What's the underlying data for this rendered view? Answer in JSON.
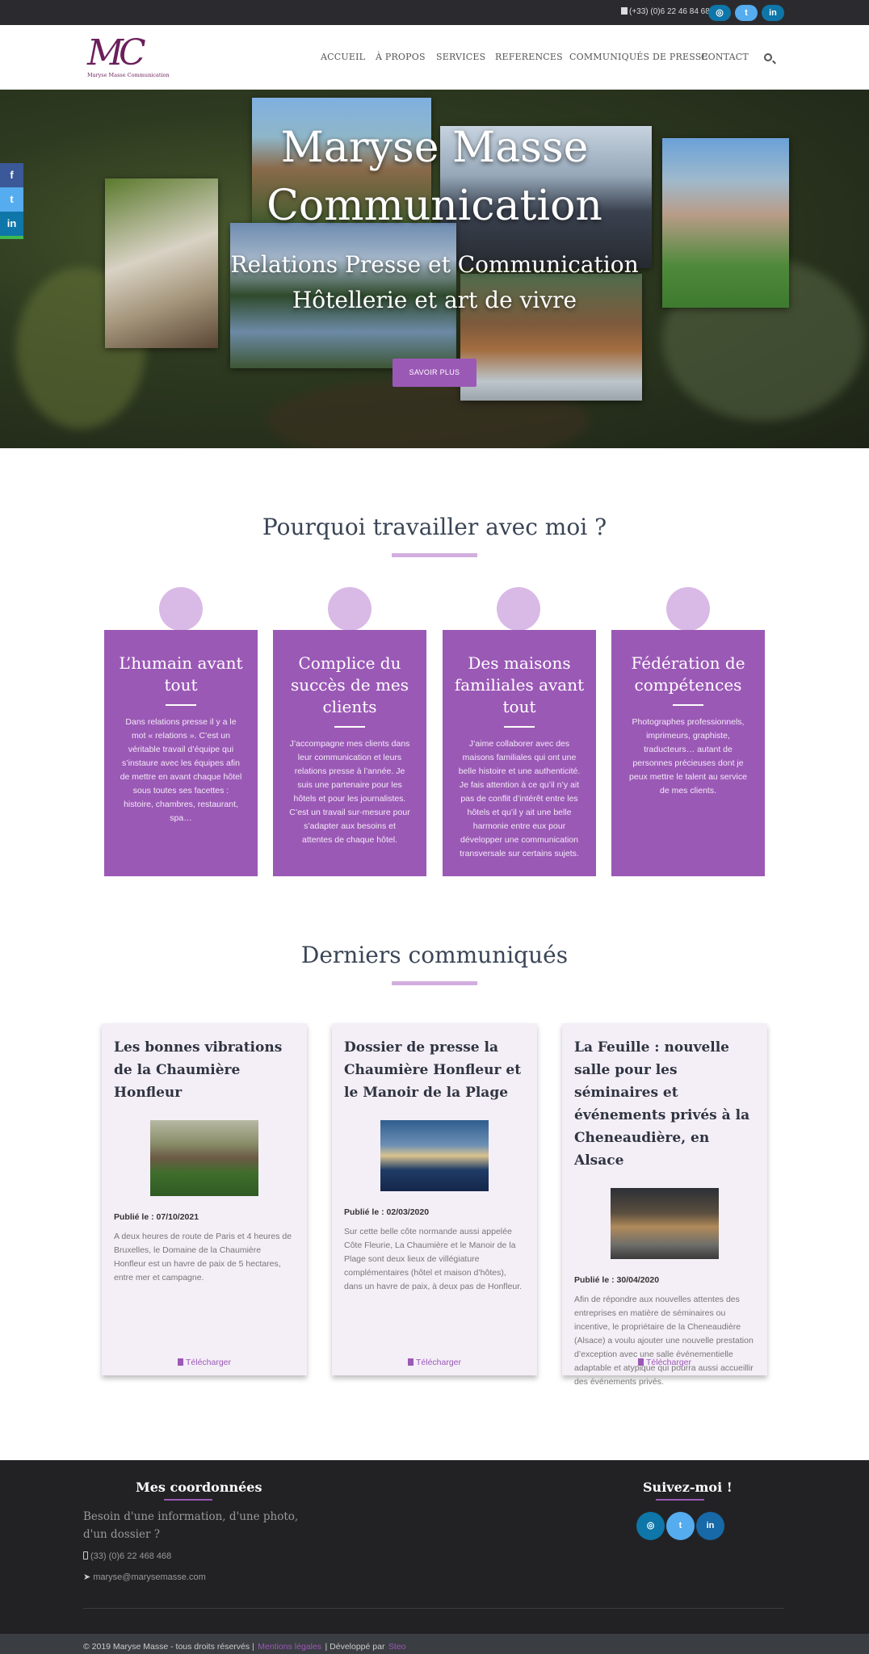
{
  "topbar": {
    "phone": "(+33) (0)6 22 46 84 68",
    "social": [
      "instagram-icon",
      "twitter-icon",
      "linkedin-icon"
    ]
  },
  "header": {
    "logo_letters": "MC",
    "logo_subtitle": "Maryse Masse Communication",
    "nav": [
      "ACCUEIL",
      "À PROPOS",
      "SERVICES",
      "REFERENCES",
      "COMMUNIQUÉS DE PRESSE",
      "CONTACT"
    ]
  },
  "hero": {
    "title_line1": "Maryse Masse",
    "title_line2": "Communication",
    "subtitle_line1": "Relations Presse et Communication",
    "subtitle_line2": "Hôtellerie et art de vivre",
    "button": "SAVOIR PLUS"
  },
  "side_social": [
    "f",
    "t",
    "in"
  ],
  "why": {
    "title": "Pourquoi travailler avec moi ?",
    "cards": [
      {
        "icon": "people-icon",
        "title": "L’humain avant tout",
        "text": "Dans relations presse il y a le mot « relations ». C’est un véritable travail d’équipe qui s’instaure avec les équipes afin de mettre en avant chaque hôtel sous toutes ses facettes : histoire, chambres, restaurant, spa…"
      },
      {
        "icon": "comments-icon",
        "title": "Complice du succès de mes clients",
        "text": "J’accompagne mes clients dans leur communication et leurs relations presse à l’année. Je suis une partenaire pour les hôtels et pour les journalistes. C’est un travail sur-mesure pour s’adapter aux besoins et attentes de chaque hôtel."
      },
      {
        "icon": "feather-icon",
        "title": "Des maisons familiales avant tout",
        "text": "J’aime collaborer avec des maisons familiales qui ont une belle histoire et une authenticité. Je fais attention à ce qu’il n’y ait pas de conflit d’intérêt entre les hôtels et qu’il y ait une belle harmonie entre eux pour développer une communication transversale sur certains sujets."
      },
      {
        "icon": "sitemap-icon",
        "title": "Fédération de compétences",
        "text": "Photographes professionnels, imprimeurs, graphiste, traducteurs… autant de personnes précieuses dont je peux mettre le talent au service de mes clients."
      }
    ]
  },
  "communiques": {
    "title": "Derniers communiqués",
    "items": [
      {
        "title": "Les bonnes vibrations de la Chaumière Honfleur",
        "date": "Publié le : 07/10/2021",
        "text": "A deux heures de route de Paris et 4 heures de Bruxelles, le Domaine de la Chaumière Honfleur est un havre de paix de 5 hectares, entre mer et campagne.",
        "download": "Télécharger"
      },
      {
        "title": "Dossier de presse la Chaumière Honfleur et le Manoir de la Plage",
        "date": "Publié le : 02/03/2020",
        "text": "Sur cette belle côte normande aussi appelée Côte Fleurie, La Chaumière et le Manoir de la Plage sont deux lieux de villégiature complémentaires (hôtel et maison d’hôtes), dans un havre de paix, à deux pas de Honfleur.",
        "download": "Télécharger"
      },
      {
        "title": "La Feuille : nouvelle salle pour les séminaires et événements privés à la Cheneaudière, en Alsace",
        "date": "Publié le : 30/04/2020",
        "text": "Afin de répondre aux nouvelles attentes des entreprises en matière de séminaires ou incentive, le propriétaire de la Cheneaudière (Alsace) a voulu ajouter une nouvelle prestation d’exception avec une salle événementielle adaptable et atypique qui pourra aussi accueillir des événements privés.",
        "download": "Télécharger"
      }
    ]
  },
  "footer": {
    "contact_title": "Mes coordonnées",
    "contact_text": "Besoin d'une information, d'une photo, d'un dossier ?",
    "phone": "(33) (0)6 22 468 468",
    "email": "maryse@marysemasse.com",
    "follow_title": "Suivez-moi !",
    "copyright": "© 2019 Maryse Masse - tous droits réservés |",
    "legal_link": "Mentions légales",
    "dev_text": "| Développé par",
    "dev_link": "Steo"
  },
  "colors": {
    "accent": "#9b59b6",
    "accent_light": "#d2aee0",
    "dark": "#222225"
  }
}
